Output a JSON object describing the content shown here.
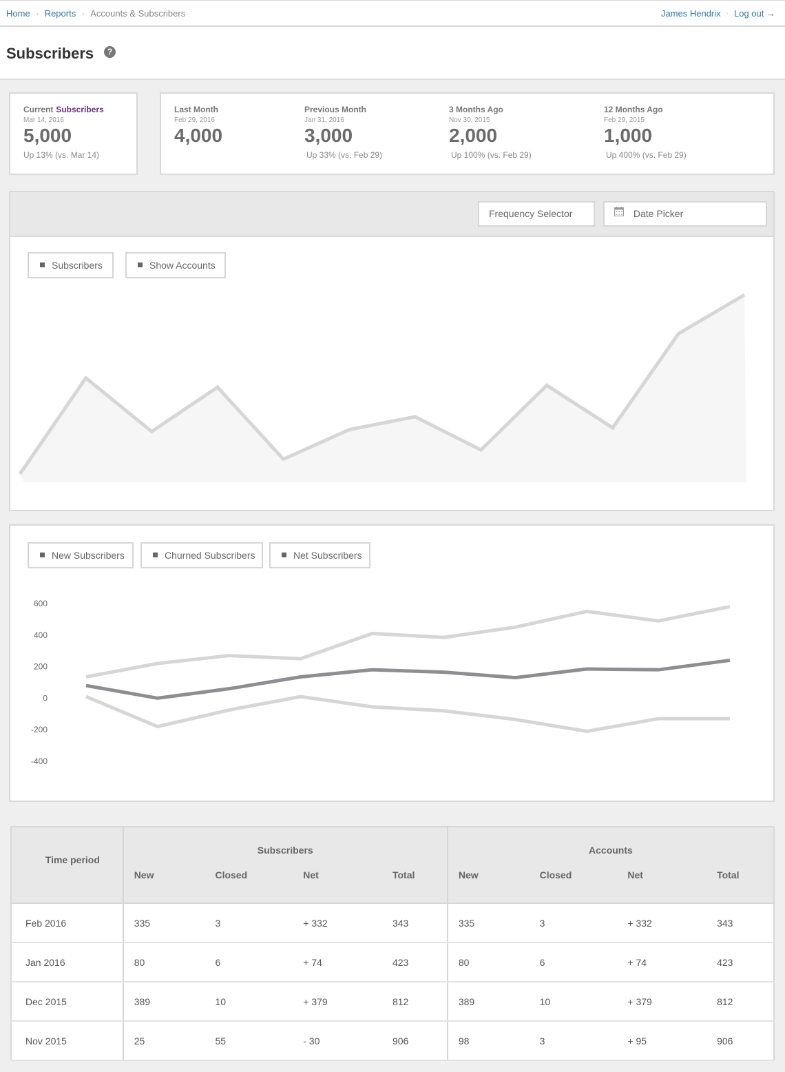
{
  "nav": {
    "breadcrumbs": [
      "Home",
      "Reports",
      "Accounts & Subscribers"
    ],
    "user": "James Hendrix",
    "logout": "Log out →"
  },
  "page": {
    "title": "Subscribers",
    "help_icon": "?"
  },
  "current": {
    "label": "Current",
    "accent": "Subscribers",
    "date": "Mar 14, 2016",
    "value": "5,000",
    "change": "Up 13% (vs. Mar 14)"
  },
  "history": [
    {
      "label": "Last Month",
      "date": "Feb 29, 2016",
      "value": "4,000",
      "change": ""
    },
    {
      "label": "Previous Month",
      "date": "Jan 31, 2016",
      "value": "3,000",
      "change": "Up 33% (vs. Feb 29)"
    },
    {
      "label": "3 Months Ago",
      "date": "Nov 30, 2015",
      "value": "2,000",
      "change": "Up 100% (vs. Feb 29)"
    },
    {
      "label": "12 Months Ago",
      "date": "Feb 29, 2015",
      "value": "1,000",
      "change": "Up 400% (vs. Feb 29)"
    }
  ],
  "controls": {
    "frequency": "Frequency Selector",
    "date_picker": "Date Picker"
  },
  "chart1": {
    "legend": [
      "Subscribers",
      "Show Accounts"
    ]
  },
  "chart2": {
    "legend": [
      "New Subscribers",
      "Churned Subscribers",
      "Net Subscribers"
    ]
  },
  "chart_data": [
    {
      "type": "area",
      "title": "",
      "series": [
        {
          "values": [
            0.03,
            0.55,
            0.26,
            0.5,
            0.11,
            0.27,
            0.34,
            0.16,
            0.51,
            0.28,
            0.79,
            1.0
          ]
        }
      ],
      "colors": [
        "#d6d6d6"
      ]
    },
    {
      "type": "line",
      "yticks": [
        600,
        400,
        200,
        0,
        -200,
        -400
      ],
      "ylim": [
        -400,
        600
      ],
      "series": [
        {
          "name": "New Subscribers",
          "color": "#d6d6d6",
          "values": [
            135,
            220,
            270,
            250,
            410,
            385,
            450,
            550,
            490,
            580
          ]
        },
        {
          "name": "Churned Subscribers",
          "color": "#d6d6d6",
          "values": [
            10,
            -180,
            -75,
            10,
            -55,
            -80,
            -135,
            -210,
            -130,
            -130
          ]
        },
        {
          "name": "Net Subscribers",
          "color": "#8e8e92",
          "values": [
            80,
            0,
            60,
            135,
            180,
            165,
            130,
            185,
            180,
            240
          ]
        }
      ]
    }
  ],
  "table": {
    "groups": [
      "Subscribers",
      "Accounts"
    ],
    "period_header": "Time period",
    "columns": [
      "New",
      "Closed",
      "Net",
      "Total"
    ],
    "rows": [
      {
        "period": "Feb 2016",
        "s_new": "335",
        "s_closed": "3",
        "s_net": "+ 332",
        "s_total": "343",
        "a_new": "335",
        "a_closed": "3",
        "a_net": "+ 332",
        "a_total": "343"
      },
      {
        "period": "Jan 2016",
        "s_new": "80",
        "s_closed": "6",
        "s_net": "+ 74",
        "s_total": "423",
        "a_new": "80",
        "a_closed": "6",
        "a_net": "+ 74",
        "a_total": "423"
      },
      {
        "period": "Dec 2015",
        "s_new": "389",
        "s_closed": "10",
        "s_net": "+ 379",
        "s_total": "812",
        "a_new": "389",
        "a_closed": "10",
        "a_net": "+ 379",
        "a_total": "812"
      },
      {
        "period": "Nov 2015",
        "s_new": "25",
        "s_closed": "55",
        "s_net": "- 30",
        "s_total": "906",
        "a_new": "98",
        "a_closed": "3",
        "a_net": "+ 95",
        "a_total": "906"
      }
    ]
  }
}
